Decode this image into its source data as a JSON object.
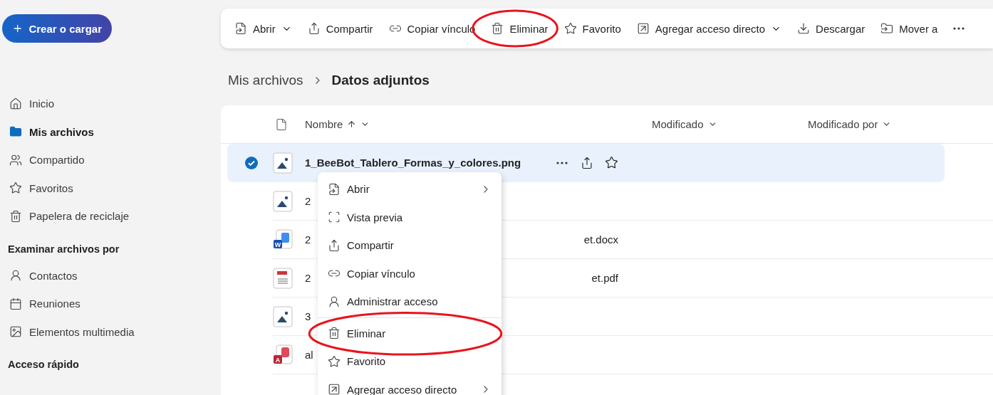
{
  "new_button": {
    "label": "Crear o cargar"
  },
  "sidebar": {
    "items": [
      {
        "label": "Inicio",
        "selected": false
      },
      {
        "label": "Mis archivos",
        "selected": true
      },
      {
        "label": "Compartido",
        "selected": false
      },
      {
        "label": "Favoritos",
        "selected": false
      },
      {
        "label": "Papelera de reciclaje",
        "selected": false
      }
    ],
    "sections": [
      {
        "title": "Examinar archivos por",
        "items": [
          {
            "label": "Contactos",
            "selected": false
          },
          {
            "label": "Reuniones",
            "selected": false
          },
          {
            "label": "Elementos multimedia",
            "selected": false
          }
        ]
      },
      {
        "title": "Acceso rápido"
      }
    ]
  },
  "toolbar": {
    "items": [
      {
        "label": "Abrir",
        "dropdown": true
      },
      {
        "label": "Compartir",
        "dropdown": false
      },
      {
        "label": "Copiar vínculo",
        "dropdown": false
      },
      {
        "label": "Eliminar",
        "dropdown": false,
        "highlighted": true
      },
      {
        "label": "Favorito",
        "dropdown": false
      },
      {
        "label": "Agregar acceso directo",
        "dropdown": true
      },
      {
        "label": "Descargar",
        "dropdown": false
      },
      {
        "label": "Mover a",
        "dropdown": false
      }
    ]
  },
  "breadcrumb": [
    {
      "label": "Mis archivos",
      "current": false
    },
    {
      "label": "Datos adjuntos",
      "current": true
    }
  ],
  "file_list": {
    "columns": [
      {
        "label": "Nombre",
        "sorted": true
      },
      {
        "label": "Modificado"
      },
      {
        "label": "Modificado por"
      }
    ],
    "rows": [
      {
        "kind": "image",
        "name_start": "1_BeeBot_Tablero_Formas_y_colores.png",
        "selected": true
      },
      {
        "kind": "image",
        "name_start": "2",
        "selected": false
      },
      {
        "kind": "word",
        "badge": "W",
        "name_start": "2",
        "name_end": "et.docx",
        "selected": false
      },
      {
        "kind": "pdf",
        "name_start": "2",
        "name_end": "et.pdf",
        "selected": false
      },
      {
        "kind": "image",
        "name_start": "3",
        "selected": false
      },
      {
        "kind": "access",
        "badge": "A",
        "name_start": "al",
        "selected": false
      }
    ]
  },
  "context_menu": {
    "items": [
      {
        "kind": "item",
        "label": "Abrir",
        "submenu": true
      },
      {
        "kind": "item",
        "label": "Vista previa",
        "submenu": false
      },
      {
        "kind": "item",
        "label": "Compartir",
        "submenu": false
      },
      {
        "kind": "item",
        "label": "Copiar vínculo",
        "submenu": false
      },
      {
        "kind": "item",
        "label": "Administrar acceso",
        "submenu": false
      },
      {
        "kind": "divider"
      },
      {
        "kind": "item",
        "label": "Eliminar",
        "submenu": false,
        "highlighted": true
      },
      {
        "kind": "item",
        "label": "Favorito",
        "submenu": false
      },
      {
        "kind": "item",
        "label": "Agregar acceso directo",
        "submenu": true
      }
    ]
  }
}
